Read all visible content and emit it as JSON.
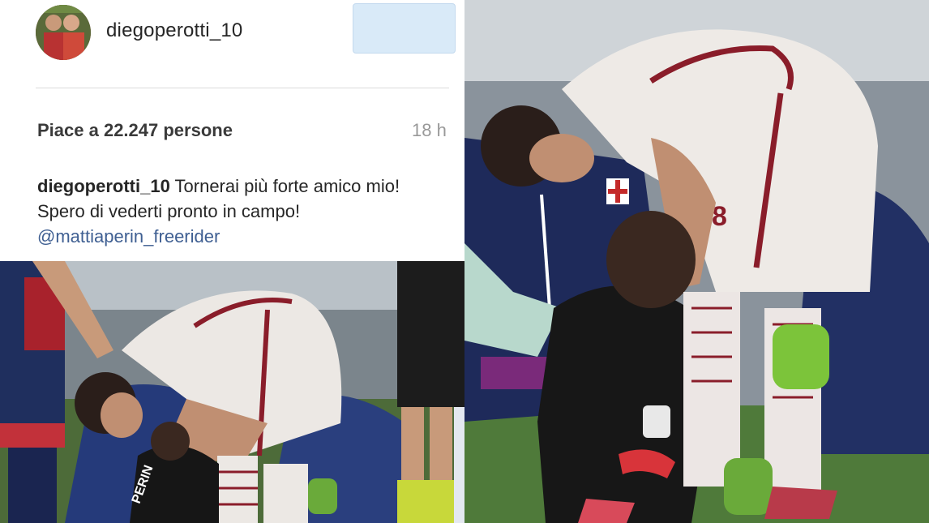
{
  "post": {
    "username": "diegoperotti_10",
    "likes_text": "Piace a 22.247 persone",
    "time_ago": "18 h",
    "caption_user": "diegoperotti_10",
    "caption_text": " Tornerai più forte amico mio! Spero di vederti pronto in campo! ",
    "caption_mention": "@mattiaperin_freerider"
  },
  "photos": {
    "left_description_visible_text": "PERIN",
    "right_shirt_number": "8"
  },
  "colors": {
    "link_blue": "#3f5f92",
    "follow_button": "#d9eaf8",
    "text_dark": "#262626",
    "text_muted": "#999999"
  }
}
